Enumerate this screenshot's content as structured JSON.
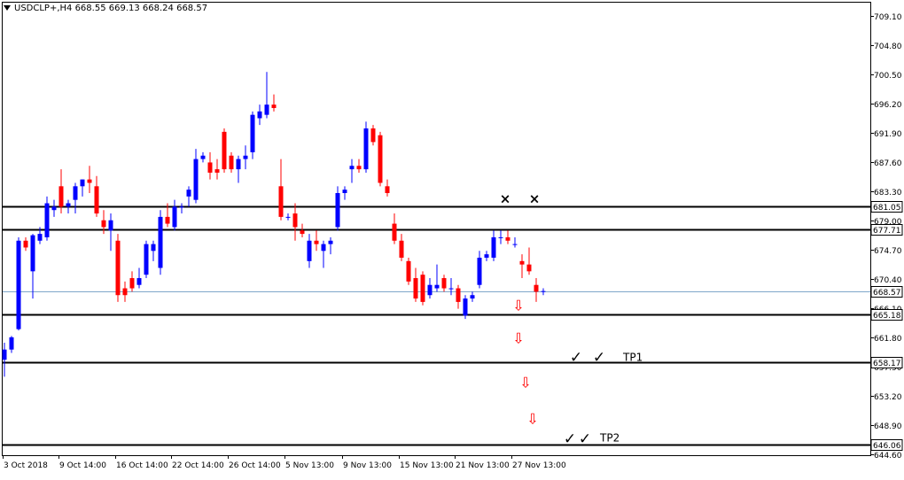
{
  "header": {
    "symbol_info": "USDCLP+,H4 668.55 669.13 668.24 668.57"
  },
  "colors": {
    "bull": "#0000ff",
    "bear": "#ff0000",
    "hline": "#000000",
    "price_line": "#7fa7c9",
    "arrow": "#ff0000"
  },
  "chart_data": {
    "type": "candlestick",
    "ylim": [
      644.6,
      711.0
    ],
    "y_ticks": [
      "709.10",
      "704.80",
      "700.50",
      "696.20",
      "691.90",
      "687.60",
      "683.30",
      "679.00",
      "674.70",
      "670.40",
      "666.10",
      "661.80",
      "657.50",
      "653.20",
      "648.90",
      "644.60"
    ],
    "x_labels": [
      "3 Oct 2018",
      "9 Oct 14:00",
      "16 Oct 14:00",
      "22 Oct 14:00",
      "26 Oct 14:00",
      "5 Nov 13:00",
      "9 Nov 13:00",
      "15 Nov 13:00",
      "21 Nov 13:00",
      "27 Nov 13:00"
    ],
    "levels": [
      {
        "value": 681.05,
        "label": "681.05"
      },
      {
        "value": 677.71,
        "label": "677.71"
      },
      {
        "value": 665.18,
        "label": "665.18"
      },
      {
        "value": 658.17,
        "label": "658.17"
      },
      {
        "value": 646.06,
        "label": "646.06"
      }
    ],
    "current_price": {
      "value": 668.57,
      "label": "668.57"
    },
    "annotations": [
      {
        "type": "text",
        "text": "TP1",
        "y": 659.5
      },
      {
        "type": "text",
        "text": "TP2",
        "y": 647.5
      },
      {
        "type": "cross",
        "text": "×"
      },
      {
        "type": "cross",
        "text": "×"
      },
      {
        "type": "check",
        "text": "✓"
      },
      {
        "type": "check",
        "text": "✓"
      },
      {
        "type": "check",
        "text": "✓"
      },
      {
        "type": "check",
        "text": "✓"
      },
      {
        "type": "arrow",
        "text": "⇩"
      },
      {
        "type": "arrow",
        "text": "⇩"
      },
      {
        "type": "arrow",
        "text": "⇩"
      },
      {
        "type": "arrow",
        "text": "⇩"
      }
    ],
    "candles": [
      {
        "o": 658.5,
        "h": 661.0,
        "l": 656.0,
        "c": 660.0
      },
      {
        "o": 660.0,
        "h": 662.0,
        "l": 659.5,
        "c": 661.8
      },
      {
        "o": 663.0,
        "h": 676.5,
        "l": 662.8,
        "c": 676.0
      },
      {
        "o": 676.0,
        "h": 676.5,
        "l": 674.5,
        "c": 675.0
      },
      {
        "o": 671.5,
        "h": 677.0,
        "l": 667.5,
        "c": 676.8
      },
      {
        "o": 676.0,
        "h": 678.0,
        "l": 675.5,
        "c": 677.0
      },
      {
        "o": 676.5,
        "h": 682.5,
        "l": 676.0,
        "c": 681.5
      },
      {
        "o": 680.5,
        "h": 682.0,
        "l": 679.5,
        "c": 681.0
      },
      {
        "o": 684.0,
        "h": 686.5,
        "l": 680.0,
        "c": 681.0
      },
      {
        "o": 681.0,
        "h": 682.0,
        "l": 680.0,
        "c": 681.5
      },
      {
        "o": 682.0,
        "h": 684.5,
        "l": 680.0,
        "c": 684.0
      },
      {
        "o": 684.0,
        "h": 685.0,
        "l": 682.5,
        "c": 685.0
      },
      {
        "o": 685.0,
        "h": 687.0,
        "l": 683.0,
        "c": 684.5
      },
      {
        "o": 684.0,
        "h": 685.5,
        "l": 679.5,
        "c": 680.0
      },
      {
        "o": 679.0,
        "h": 680.5,
        "l": 677.0,
        "c": 678.0
      },
      {
        "o": 677.5,
        "h": 680.0,
        "l": 674.5,
        "c": 679.0
      },
      {
        "o": 676.0,
        "h": 677.0,
        "l": 667.0,
        "c": 668.0
      },
      {
        "o": 669.0,
        "h": 670.0,
        "l": 667.0,
        "c": 668.0
      },
      {
        "o": 670.5,
        "h": 671.5,
        "l": 668.5,
        "c": 669.0
      },
      {
        "o": 669.5,
        "h": 672.0,
        "l": 669.0,
        "c": 670.5
      },
      {
        "o": 671.0,
        "h": 676.0,
        "l": 670.5,
        "c": 675.5
      },
      {
        "o": 674.5,
        "h": 676.0,
        "l": 673.0,
        "c": 675.5
      },
      {
        "o": 672.0,
        "h": 680.5,
        "l": 671.0,
        "c": 679.5
      },
      {
        "o": 679.5,
        "h": 681.5,
        "l": 678.0,
        "c": 678.5
      },
      {
        "o": 678.0,
        "h": 682.0,
        "l": 677.5,
        "c": 681.0
      },
      {
        "o": 681.0,
        "h": 681.5,
        "l": 680.0,
        "c": 681.0
      },
      {
        "o": 682.5,
        "h": 684.0,
        "l": 681.0,
        "c": 683.5
      },
      {
        "o": 682.0,
        "h": 689.5,
        "l": 681.5,
        "c": 688.0
      },
      {
        "o": 688.0,
        "h": 689.0,
        "l": 687.5,
        "c": 688.5
      },
      {
        "o": 687.5,
        "h": 689.0,
        "l": 685.0,
        "c": 686.0
      },
      {
        "o": 686.5,
        "h": 688.0,
        "l": 685.0,
        "c": 686.0
      },
      {
        "o": 692.0,
        "h": 692.5,
        "l": 686.0,
        "c": 686.5
      },
      {
        "o": 688.5,
        "h": 689.0,
        "l": 686.0,
        "c": 686.5
      },
      {
        "o": 686.5,
        "h": 688.5,
        "l": 684.5,
        "c": 688.0
      },
      {
        "o": 688.0,
        "h": 690.0,
        "l": 686.5,
        "c": 688.5
      },
      {
        "o": 689.0,
        "h": 695.0,
        "l": 688.0,
        "c": 694.5
      },
      {
        "o": 694.0,
        "h": 696.0,
        "l": 693.0,
        "c": 695.0
      },
      {
        "o": 694.5,
        "h": 700.8,
        "l": 694.0,
        "c": 696.0
      },
      {
        "o": 696.0,
        "h": 697.5,
        "l": 695.0,
        "c": 695.5
      },
      {
        "o": 684.0,
        "h": 688.0,
        "l": 679.0,
        "c": 679.5
      },
      {
        "o": 679.5,
        "h": 680.0,
        "l": 679.0,
        "c": 679.5
      },
      {
        "o": 680.0,
        "h": 681.5,
        "l": 676.0,
        "c": 678.0
      },
      {
        "o": 677.5,
        "h": 678.5,
        "l": 676.5,
        "c": 677.0
      },
      {
        "o": 673.0,
        "h": 677.0,
        "l": 672.0,
        "c": 676.0
      },
      {
        "o": 676.0,
        "h": 677.5,
        "l": 674.5,
        "c": 675.5
      },
      {
        "o": 674.5,
        "h": 676.0,
        "l": 672.0,
        "c": 675.5
      },
      {
        "o": 675.5,
        "h": 676.5,
        "l": 674.0,
        "c": 676.0
      },
      {
        "o": 678.0,
        "h": 684.0,
        "l": 677.5,
        "c": 683.0
      },
      {
        "o": 683.0,
        "h": 684.0,
        "l": 682.0,
        "c": 683.5
      },
      {
        "o": 686.5,
        "h": 688.0,
        "l": 684.5,
        "c": 687.0
      },
      {
        "o": 687.0,
        "h": 688.0,
        "l": 686.0,
        "c": 686.5
      },
      {
        "o": 686.5,
        "h": 693.5,
        "l": 686.0,
        "c": 692.5
      },
      {
        "o": 692.5,
        "h": 693.0,
        "l": 690.0,
        "c": 690.5
      },
      {
        "o": 691.5,
        "h": 692.0,
        "l": 684.0,
        "c": 684.5
      },
      {
        "o": 684.0,
        "h": 685.0,
        "l": 682.5,
        "c": 683.0
      },
      {
        "o": 678.5,
        "h": 680.0,
        "l": 675.5,
        "c": 676.0
      },
      {
        "o": 676.0,
        "h": 677.0,
        "l": 673.0,
        "c": 673.5
      },
      {
        "o": 673.0,
        "h": 673.5,
        "l": 669.5,
        "c": 670.0
      },
      {
        "o": 670.5,
        "h": 672.0,
        "l": 667.0,
        "c": 667.5
      },
      {
        "o": 671.0,
        "h": 671.5,
        "l": 666.5,
        "c": 667.0
      },
      {
        "o": 668.0,
        "h": 670.5,
        "l": 667.5,
        "c": 669.5
      },
      {
        "o": 669.0,
        "h": 672.5,
        "l": 668.5,
        "c": 669.5
      },
      {
        "o": 670.5,
        "h": 671.0,
        "l": 668.5,
        "c": 669.0
      },
      {
        "o": 669.0,
        "h": 670.5,
        "l": 668.0,
        "c": 669.0
      },
      {
        "o": 669.0,
        "h": 669.5,
        "l": 666.0,
        "c": 667.0
      },
      {
        "o": 665.0,
        "h": 668.0,
        "l": 664.5,
        "c": 667.5
      },
      {
        "o": 667.5,
        "h": 668.5,
        "l": 667.0,
        "c": 668.0
      },
      {
        "o": 669.5,
        "h": 674.5,
        "l": 669.0,
        "c": 673.5
      },
      {
        "o": 673.5,
        "h": 674.5,
        "l": 673.0,
        "c": 674.0
      },
      {
        "o": 673.5,
        "h": 677.5,
        "l": 673.0,
        "c": 676.5
      },
      {
        "o": 676.5,
        "h": 677.5,
        "l": 675.5,
        "c": 676.5
      },
      {
        "o": 676.5,
        "h": 677.5,
        "l": 675.5,
        "c": 676.0
      },
      {
        "o": 675.5,
        "h": 676.5,
        "l": 675.0,
        "c": 675.5
      },
      {
        "o": 673.0,
        "h": 674.0,
        "l": 670.5,
        "c": 672.5
      },
      {
        "o": 672.5,
        "h": 675.0,
        "l": 671.0,
        "c": 671.5
      },
      {
        "o": 669.5,
        "h": 670.5,
        "l": 667.0,
        "c": 668.5
      },
      {
        "o": 668.5,
        "h": 669.0,
        "l": 668.0,
        "c": 668.6
      }
    ]
  }
}
